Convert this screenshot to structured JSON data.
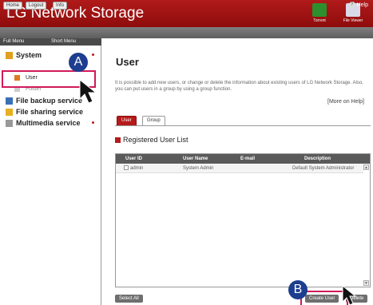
{
  "header": {
    "title": "LG Network Storage",
    "torrent_label": "Torrent",
    "file_viewer_label": "File Viewer",
    "colors": {
      "bar": "#a51515",
      "accent": "#b51b1b"
    }
  },
  "toolbar": {
    "home": "Home",
    "logout": "Logout",
    "info": "Info",
    "help": "Help"
  },
  "sidebar": {
    "full_menu": "Full Menu",
    "short_menu": "Short Menu",
    "items": [
      {
        "label": "System",
        "icon": "system-icon"
      },
      {
        "label": "User",
        "icon": "user-icon"
      },
      {
        "label": "Folder",
        "icon": "folder-icon"
      },
      {
        "label": "File backup service",
        "icon": "backup-icon"
      },
      {
        "label": "File sharing service",
        "icon": "sharing-icon"
      },
      {
        "label": "Multimedia service",
        "icon": "multimedia-icon"
      }
    ]
  },
  "main": {
    "title": "User",
    "description": "It is possible to add new users, or change or delete the information about existing users of LG Network Storage. Also, you can put users in a group by using a group function.",
    "more_help": "[More on Help]",
    "tabs": [
      "User",
      "Group"
    ],
    "section_title": "Registered User List",
    "table": {
      "columns": [
        "User ID",
        "User Name",
        "E-mail",
        "Description"
      ],
      "rows": [
        {
          "user_id": "admin",
          "user_name": "System Admin",
          "email": "",
          "description": "Default System Administrator"
        }
      ]
    },
    "buttons": {
      "select_all": "Select All",
      "create_user": "Create User",
      "delete": "Delete"
    }
  },
  "annotations": {
    "a": "A",
    "b": "B"
  }
}
